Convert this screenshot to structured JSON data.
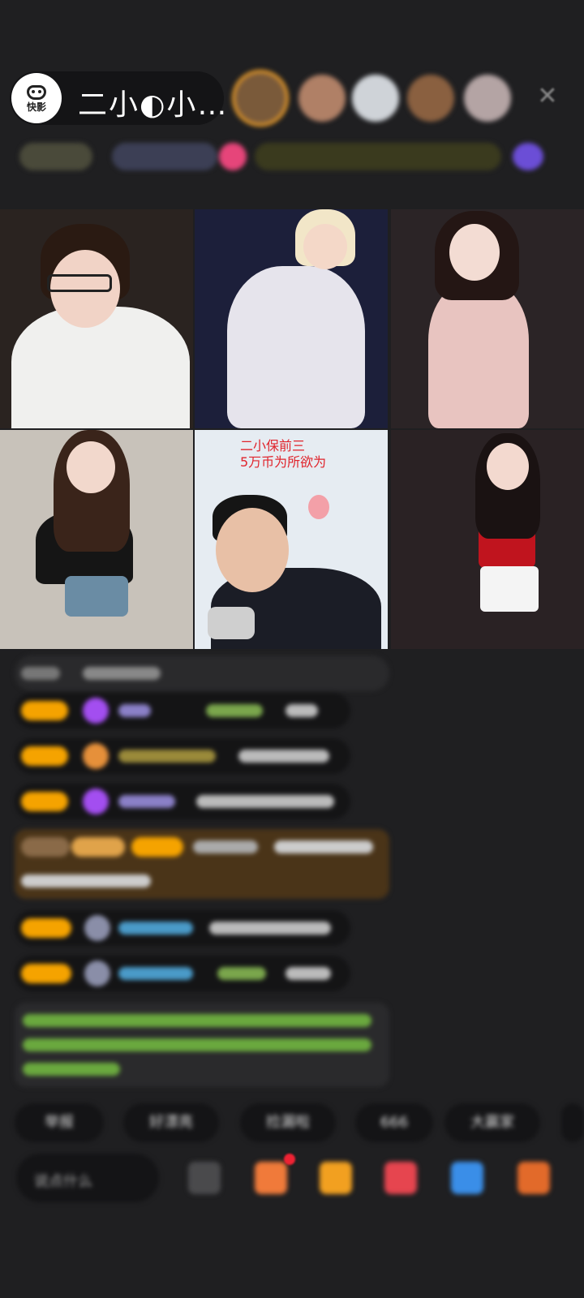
{
  "host": {
    "logo_text": "快影",
    "name": "二小◐小…"
  },
  "close_icon": "close-icon",
  "viewers": [
    {
      "name": "viewer-1"
    },
    {
      "name": "viewer-2"
    },
    {
      "name": "viewer-3"
    },
    {
      "name": "viewer-4"
    },
    {
      "name": "viewer-5"
    }
  ],
  "streams": {
    "caption_line1": "二小保前三",
    "caption_line2": "5万币为所欲为"
  },
  "quick_actions": [
    "举报",
    "好漂亮",
    "捡漏啦",
    "666",
    "大赢家"
  ],
  "input": {
    "placeholder": "说点什么"
  },
  "colors": {
    "background": "#1f1f21",
    "pill": "#141416",
    "accent_orange": "#f5a300",
    "accent_purple": "#9b5cf6",
    "caption_red": "#e0242c"
  }
}
